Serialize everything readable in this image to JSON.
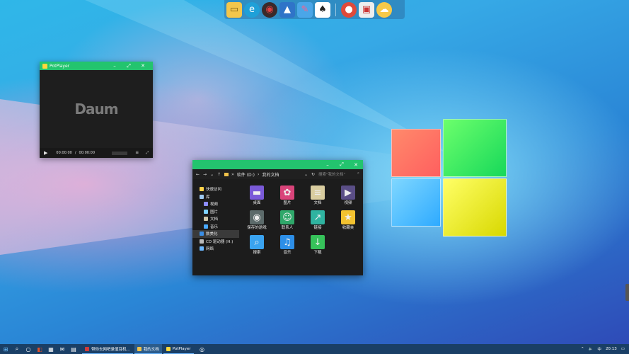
{
  "dock": {
    "icons": [
      "folder-icon",
      "edge-icon",
      "music-player-icon",
      "photos-icon",
      "paint-icon",
      "solitaire-icon",
      "maps-pin-icon",
      "screen-capture-icon",
      "weather-icon"
    ]
  },
  "potplayer": {
    "title": "PotPlayer",
    "logo_text": "Daum",
    "time_current": "00:00:00",
    "time_separator": "/",
    "time_total": "00:00:00",
    "min": "–",
    "max": "⤢",
    "close": "✕"
  },
  "explorer": {
    "path": [
      "软件 (D:)",
      "我的文档"
    ],
    "search_placeholder": "搜索\"我的文档\"",
    "nav": [
      {
        "label": "快速访问",
        "color": "#ffd24a",
        "sub": false
      },
      {
        "label": "库",
        "color": "#9ec9f0",
        "sub": false
      },
      {
        "label": "视频",
        "color": "#8d8dff",
        "sub": true
      },
      {
        "label": "图片",
        "color": "#7fd3ff",
        "sub": true
      },
      {
        "label": "文档",
        "color": "#cfc7a8",
        "sub": true
      },
      {
        "label": "音乐",
        "color": "#49a9ff",
        "sub": true
      },
      {
        "label": "数美化",
        "color": "#3a8ee6",
        "sub": false,
        "selected": true
      },
      {
        "label": "CD 驱动器 (H:)",
        "color": "#bbbbbb",
        "sub": false
      },
      {
        "label": "网络",
        "color": "#6cb8ff",
        "sub": false
      }
    ],
    "items": [
      {
        "label": "桌面",
        "icon": "desktop-icon",
        "color": "#7a5ad8",
        "glyph": "▬"
      },
      {
        "label": "图片",
        "icon": "pictures-icon",
        "color": "#d9447a",
        "glyph": "✿"
      },
      {
        "label": "文档",
        "icon": "documents-icon",
        "color": "#d9cda0",
        "glyph": "≡"
      },
      {
        "label": "视频",
        "icon": "videos-icon",
        "color": "#5a4e86",
        "glyph": "▶"
      },
      {
        "label": "保存的游戏",
        "icon": "saved-games-icon",
        "color": "#5c6a6a",
        "glyph": "◉"
      },
      {
        "label": "联系人",
        "icon": "contacts-icon",
        "color": "#2fa86a",
        "glyph": "☺"
      },
      {
        "label": "链接",
        "icon": "links-icon",
        "color": "#2fb3a0",
        "glyph": "↗"
      },
      {
        "label": "收藏夹",
        "icon": "favorites-icon",
        "color": "#f2c230",
        "glyph": "★"
      },
      {
        "label": "搜索",
        "icon": "search-folder-icon",
        "color": "#3aa3f0",
        "glyph": "⌕"
      },
      {
        "label": "音乐",
        "icon": "music-folder-icon",
        "color": "#2d8fe8",
        "glyph": "♫"
      },
      {
        "label": "下载",
        "icon": "downloads-icon",
        "color": "#36c25a",
        "glyph": "↓"
      }
    ]
  },
  "taskbar": {
    "apps": [
      {
        "label": "带你去网吧录值耳机...",
        "icon": "browser-icon",
        "color": "#d23b3b",
        "active": false
      },
      {
        "label": "我的文档",
        "icon": "folder-icon",
        "color": "#f0c24a",
        "active": true
      },
      {
        "label": "PotPlayer",
        "icon": "potplayer-icon",
        "color": "#ffd83b",
        "active": false
      }
    ],
    "clock": "20:13",
    "tray_symbols": [
      "⌃",
      "🔈",
      "中"
    ]
  }
}
